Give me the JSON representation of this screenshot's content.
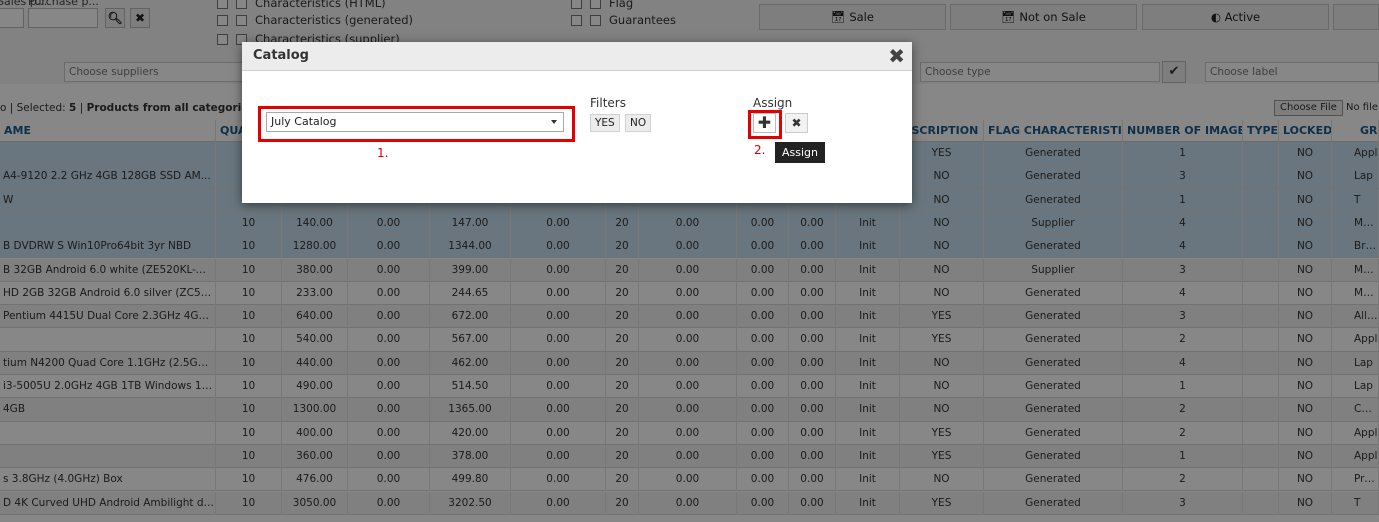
{
  "filters": {
    "label_a": "Sales p...",
    "label_b": "Purchase p...",
    "checkboxes_left": [
      "Characteristics (HTML)",
      "Characteristics (generated)",
      "Characteristics (supplier)"
    ],
    "checkboxes_right": [
      "Flag",
      "Guarantees"
    ]
  },
  "actions": [
    "Sale",
    "Not on Sale",
    "Active"
  ],
  "dropdowns": {
    "suppliers": "Choose suppliers",
    "type": "Choose type",
    "label": "Choose label"
  },
  "selection": {
    "selected_label": "Selected:",
    "count": "5",
    "scope": "Products from all categories"
  },
  "file": {
    "choose": "Choose File",
    "none": "No file c"
  },
  "table": {
    "columns": [
      "AME",
      "QUA",
      "ESCRIPTION",
      "FLAG CHARACTERISTICS.",
      "NUMBER OF IMAGES",
      "TYPE",
      "LOCKED",
      "GRO"
    ],
    "rows": [
      {
        "sel": true,
        "name": "",
        "c": [
          "",
          "",
          "",
          "",
          "",
          "",
          "",
          "",
          "",
          "",
          ""
        ],
        "desc": "YES",
        "flag": "Generated",
        "img": "1",
        "type": "",
        "locked": "NO",
        "group": "Appl"
      },
      {
        "sel": true,
        "name": "A4-9120 2.2 GHz 4GB 128GB SSD AM...",
        "c": [
          "",
          "",
          "",
          "",
          "",
          "",
          "",
          "",
          "",
          "",
          ""
        ],
        "desc": "NO",
        "flag": "Generated",
        "img": "3",
        "type": "",
        "locked": "NO",
        "group": "Lap"
      },
      {
        "sel": true,
        "name": "W",
        "c": [
          "",
          "",
          "",
          "",
          "",
          "",
          "",
          "",
          "",
          "",
          ""
        ],
        "desc": "NO",
        "flag": "Generated",
        "img": "1",
        "type": "",
        "locked": "NO",
        "group": "T"
      },
      {
        "sel": true,
        "name": "",
        "c": [
          "10",
          "140.00",
          "0.00",
          "147.00",
          "0.00",
          "20",
          "0.00",
          "0.00",
          "0.00",
          "Init"
        ],
        "desc": "NO",
        "flag": "Supplier",
        "img": "4",
        "type": "",
        "locked": "NO",
        "group": "Mothe"
      },
      {
        "sel": true,
        "name": "B DVDRW S Win10Pro64bit 3yr NBD",
        "c": [
          "10",
          "1280.00",
          "0.00",
          "1344.00",
          "0.00",
          "20",
          "0.00",
          "0.00",
          "0.00",
          "Init"
        ],
        "desc": "NO",
        "flag": "Generated",
        "img": "4",
        "type": "",
        "locked": "NO",
        "group": "Brand co"
      },
      {
        "sel": false,
        "name": "B 32GB Android 6.0 white (ZE520KL-WHI...",
        "c": [
          "10",
          "380.00",
          "0.00",
          "399.00",
          "0.00",
          "20",
          "0.00",
          "0.00",
          "0.00",
          "Init"
        ],
        "desc": "NO",
        "flag": "Supplier",
        "img": "3",
        "type": "",
        "locked": "NO",
        "group": "Mobile"
      },
      {
        "sel": false,
        "name": "HD 2GB 32GB Android 6.0 silver (ZC551K...",
        "c": [
          "10",
          "233.00",
          "0.00",
          "244.65",
          "0.00",
          "20",
          "0.00",
          "0.00",
          "0.00",
          "Init"
        ],
        "desc": "NO",
        "flag": "Generated",
        "img": "4",
        "type": "",
        "locked": "NO",
        "group": "Mobile"
      },
      {
        "sel": false,
        "name": "Pentium 4415U Dual Core 2.3GHz 4GB ...",
        "c": [
          "10",
          "640.00",
          "0.00",
          "672.00",
          "0.00",
          "20",
          "0.00",
          "0.00",
          "0.00",
          "Init"
        ],
        "desc": "YES",
        "flag": "Generated",
        "img": "3",
        "type": "",
        "locked": "NO",
        "group": "All in"
      },
      {
        "sel": false,
        "name": "",
        "c": [
          "10",
          "540.00",
          "0.00",
          "567.00",
          "0.00",
          "20",
          "0.00",
          "0.00",
          "0.00",
          "Init"
        ],
        "desc": "YES",
        "flag": "Generated",
        "img": "2",
        "type": "",
        "locked": "NO",
        "group": "Appl"
      },
      {
        "sel": false,
        "name": "tium N4200 Quad Core 1.1GHz (2.5GHz) ...",
        "c": [
          "10",
          "440.00",
          "0.00",
          "462.00",
          "0.00",
          "20",
          "0.00",
          "0.00",
          "0.00",
          "Init"
        ],
        "desc": "NO",
        "flag": "Generated",
        "img": "4",
        "type": "",
        "locked": "NO",
        "group": "Lap"
      },
      {
        "sel": false,
        "name": "i3-5005U 2.0GHz 4GB 1TB Windows 10 ...",
        "c": [
          "10",
          "490.00",
          "0.00",
          "514.50",
          "0.00",
          "20",
          "0.00",
          "0.00",
          "0.00",
          "Init"
        ],
        "desc": "NO",
        "flag": "Generated",
        "img": "1",
        "type": "",
        "locked": "NO",
        "group": "Lap"
      },
      {
        "sel": false,
        "name": "4GB",
        "c": [
          "10",
          "1300.00",
          "0.00",
          "1365.00",
          "0.00",
          "20",
          "0.00",
          "0.00",
          "0.00",
          "Init"
        ],
        "desc": "NO",
        "flag": "Generated",
        "img": "2",
        "type": "",
        "locked": "NO",
        "group": "Configu"
      },
      {
        "sel": false,
        "name": "",
        "c": [
          "10",
          "400.00",
          "0.00",
          "420.00",
          "0.00",
          "20",
          "0.00",
          "0.00",
          "0.00",
          "Init"
        ],
        "desc": "YES",
        "flag": "Generated",
        "img": "2",
        "type": "",
        "locked": "NO",
        "group": "Appl"
      },
      {
        "sel": false,
        "name": "",
        "c": [
          "10",
          "360.00",
          "0.00",
          "378.00",
          "0.00",
          "20",
          "0.00",
          "0.00",
          "0.00",
          "Init"
        ],
        "desc": "YES",
        "flag": "Generated",
        "img": "1",
        "type": "",
        "locked": "NO",
        "group": "Appl"
      },
      {
        "sel": false,
        "name": "s 3.8GHz (4.0GHz) Box",
        "c": [
          "10",
          "476.00",
          "0.00",
          "499.80",
          "0.00",
          "20",
          "0.00",
          "0.00",
          "0.00",
          "Init"
        ],
        "desc": "NO",
        "flag": "Generated",
        "img": "2",
        "type": "",
        "locked": "NO",
        "group": "Proce"
      },
      {
        "sel": false,
        "name": "D 4K Curved UHD Android Ambilight dig...",
        "c": [
          "10",
          "3050.00",
          "0.00",
          "3202.50",
          "0.00",
          "20",
          "0.00",
          "0.00",
          "0.00",
          "Init"
        ],
        "desc": "YES",
        "flag": "Generated",
        "img": "3",
        "type": "",
        "locked": "NO",
        "group": "T"
      }
    ]
  },
  "modal": {
    "title": "Catalog",
    "close": "✖",
    "catalog_value": "July Catalog",
    "step1": "1.",
    "filters_label": "Filters",
    "yes": "YES",
    "no": "NO",
    "assign_label": "Assign",
    "plus": "✚",
    "remove": "✖",
    "step2": "2.",
    "tooltip": "Assign"
  },
  "colors": {
    "accent": "#1f5a8a",
    "highlight": "#e30000",
    "selected_row": "#c7dff0"
  }
}
